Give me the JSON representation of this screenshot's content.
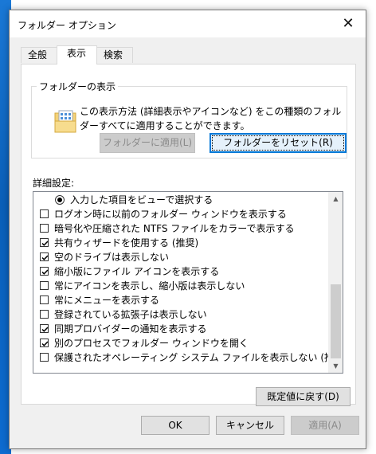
{
  "window": {
    "title": "フォルダー オプション",
    "close_glyph": "✕"
  },
  "tabs": [
    {
      "label": "全般"
    },
    {
      "label": "表示"
    },
    {
      "label": "検索"
    }
  ],
  "folder_views": {
    "legend": "フォルダーの表示",
    "description": "この表示方法 (詳細表示やアイコンなど) をこの種類のフォルダーすべてに適用することができます。",
    "apply_button": "フォルダーに適用(L)",
    "reset_button": "フォルダーをリセット(R)"
  },
  "advanced": {
    "label": "詳細設定:",
    "items": [
      {
        "type": "radio",
        "label": "入力した項目をビューで選択する",
        "checked": true
      },
      {
        "type": "checkbox",
        "label": "ログオン時に以前のフォルダー ウィンドウを表示する",
        "checked": false
      },
      {
        "type": "checkbox",
        "label": "暗号化や圧縮された NTFS ファイルをカラーで表示する",
        "checked": false
      },
      {
        "type": "checkbox",
        "label": "共有ウィザードを使用する (推奨)",
        "checked": true
      },
      {
        "type": "checkbox",
        "label": "空のドライブは表示しない",
        "checked": true
      },
      {
        "type": "checkbox",
        "label": "縮小版にファイル アイコンを表示する",
        "checked": true
      },
      {
        "type": "checkbox",
        "label": "常にアイコンを表示し、縮小版は表示しない",
        "checked": false
      },
      {
        "type": "checkbox",
        "label": "常にメニューを表示する",
        "checked": false
      },
      {
        "type": "checkbox",
        "label": "登録されている拡張子は表示しない",
        "checked": false
      },
      {
        "type": "checkbox",
        "label": "同期プロバイダーの通知を表示する",
        "checked": true
      },
      {
        "type": "checkbox",
        "label": "別のプロセスでフォルダー ウィンドウを開く",
        "checked": true
      },
      {
        "type": "checkbox",
        "label": "保護されたオペレーティング システム ファイルを表示しない (推奨)",
        "checked": false
      }
    ],
    "restore_button": "既定値に戻す(D)"
  },
  "footer": {
    "ok": "OK",
    "cancel": "キャンセル",
    "apply": "適用(A)"
  },
  "colors": {
    "focus_border": "#0078d7",
    "desktop": "#0f68c9"
  },
  "icons": {
    "folder": "folder-view-icon",
    "scroll_up": "scroll-up-arrow-icon",
    "scroll_down": "scroll-down-arrow-icon"
  }
}
